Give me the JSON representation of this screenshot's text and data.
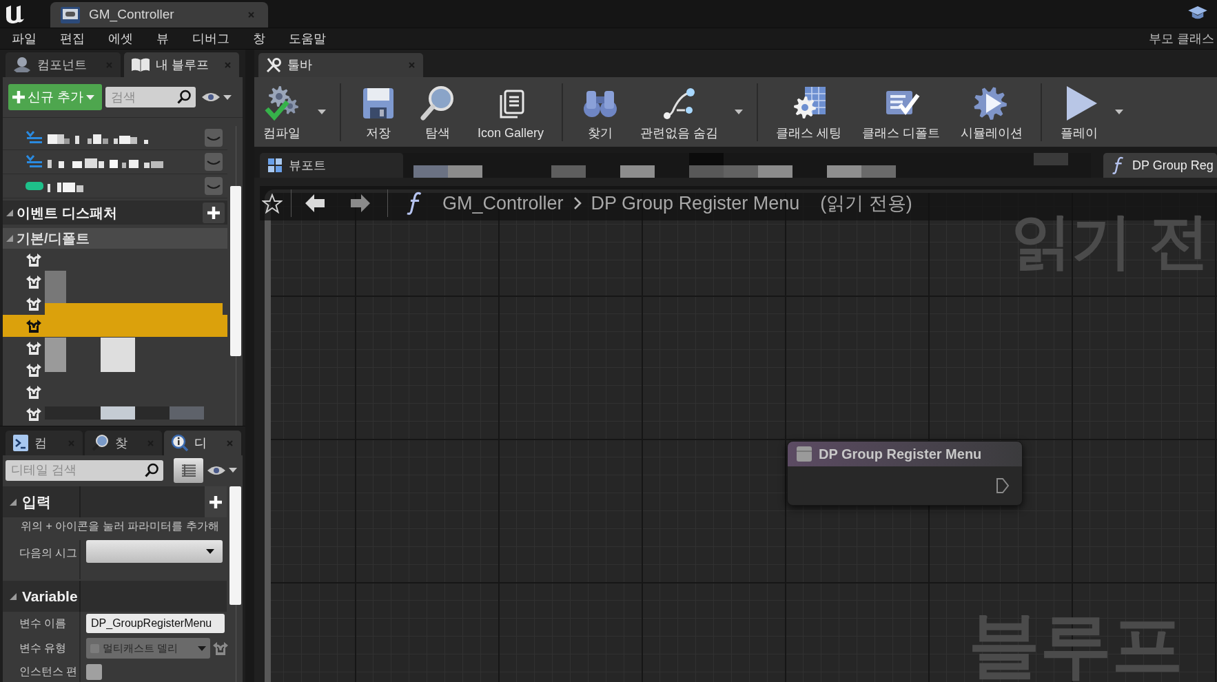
{
  "title_bar": {
    "document_tab": "GM_Controller"
  },
  "menu_bar": {
    "items": [
      "파일",
      "편집",
      "에셋",
      "뷰",
      "디버그",
      "창",
      "도움말"
    ],
    "parent_class": "부모 클래스"
  },
  "my_blueprint_panel": {
    "tabs": [
      {
        "label": "컴포넌트",
        "kind": "components",
        "selected": false
      },
      {
        "label": "내 블루프",
        "kind": "blueprint",
        "selected": true
      }
    ],
    "add_button": "신규 추가",
    "search": {
      "placeholder": "검색"
    },
    "rows": [
      {
        "kind": "struct"
      },
      {
        "kind": "struct"
      },
      {
        "kind": "variable"
      }
    ],
    "sections": [
      {
        "title": "이벤트 디스패처",
        "expanded": true,
        "can_add": true,
        "categories": [
          {
            "title": "기본/디폴트",
            "expanded": true,
            "items": [
              {
                "selected": false
              },
              {
                "selected": false
              },
              {
                "selected": false
              },
              {
                "selected": true
              },
              {
                "selected": false
              },
              {
                "selected": false
              },
              {
                "selected": false
              },
              {
                "selected": false
              }
            ]
          }
        ]
      }
    ]
  },
  "details_panel": {
    "tabs": [
      {
        "label": "컴",
        "kind": "compiler",
        "selected": false
      },
      {
        "label": "찾",
        "kind": "find",
        "selected": false
      },
      {
        "label": "디",
        "kind": "details",
        "selected": true
      }
    ],
    "search": {
      "placeholder": "디테일 검색"
    },
    "sections": [
      {
        "title": "입력",
        "expanded": true,
        "can_add": true,
        "hint": "위의 + 아이콘을 눌러 파라미터를 추가해",
        "rows": [
          {
            "label": "다음의 시그",
            "kind": "dropdown"
          }
        ]
      },
      {
        "title": "Variable",
        "expanded": true,
        "can_add": false,
        "rows": [
          {
            "label": "변수 이름",
            "kind": "text",
            "value": "DP_GroupRegisterMenu"
          },
          {
            "label": "변수 유형",
            "kind": "type",
            "value": "멀티캐스트 델리",
            "disabled": true
          },
          {
            "label": "인스턴스 편",
            "kind": "checkbox",
            "checked": false
          }
        ]
      }
    ]
  },
  "toolbar": {
    "tab": "툴바",
    "groups": [
      {
        "buttons": [
          {
            "label": "컴파일",
            "kind": "compile",
            "has_menu": true
          }
        ]
      },
      {
        "buttons": [
          {
            "label": "저장",
            "kind": "save",
            "has_menu": false
          },
          {
            "label": "탐색",
            "kind": "browse",
            "has_menu": false
          },
          {
            "label": "Icon Gallery",
            "kind": "gallery",
            "has_menu": false
          }
        ]
      },
      {
        "buttons": [
          {
            "label": "찾기",
            "kind": "find",
            "has_menu": false
          },
          {
            "label": "관련없음 숨김",
            "kind": "hide_unrelated",
            "has_menu": true
          }
        ]
      },
      {
        "buttons": [
          {
            "label": "클래스 세팅",
            "kind": "class_settings",
            "has_menu": false
          },
          {
            "label": "클래스 디폴트",
            "kind": "class_defaults",
            "has_menu": false
          },
          {
            "label": "시뮬레이션",
            "kind": "simulation",
            "has_menu": false
          }
        ]
      },
      {
        "buttons": [
          {
            "label": "플레이",
            "kind": "play",
            "has_menu": true
          }
        ]
      }
    ]
  },
  "graph_tabs": [
    {
      "label": "뷰포트",
      "kind": "viewport",
      "selected": false
    },
    {
      "label": "DP Group Reg",
      "kind": "function",
      "selected": true
    }
  ],
  "breadcrumb": {
    "path": [
      "GM_Controller",
      "DP Group Register Menu"
    ],
    "note": "(읽기 전용)"
  },
  "graph": {
    "read_only_label": "읽기 전",
    "watermark": "블루프",
    "nodes": [
      {
        "title": "DP Group Register Menu"
      }
    ]
  }
}
